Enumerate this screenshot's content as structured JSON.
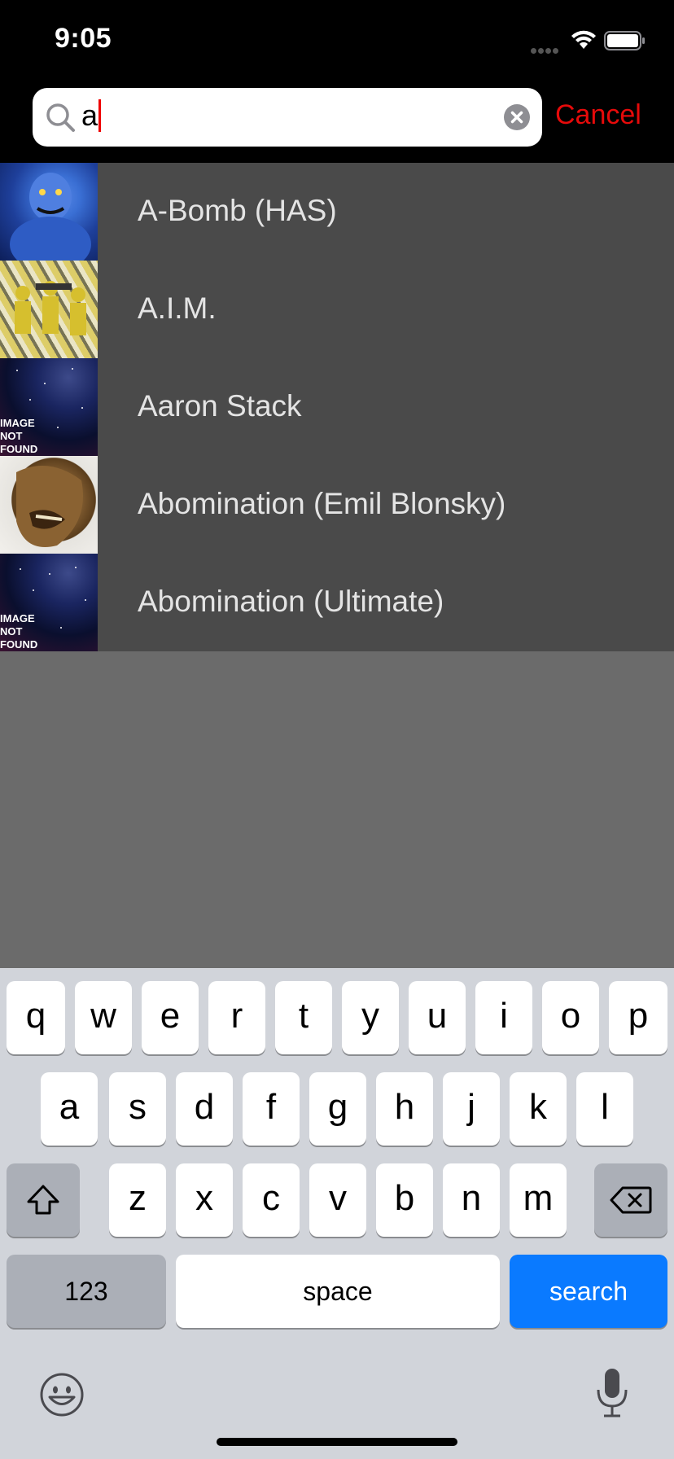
{
  "status_bar": {
    "time": "9:05"
  },
  "search": {
    "value": "a",
    "cancel_label": "Cancel",
    "caret_color": "#e00000"
  },
  "results": [
    {
      "label": "A-Bomb (HAS)",
      "thumb": "a-bomb-image"
    },
    {
      "label": "A.I.M.",
      "thumb": "aim-image"
    },
    {
      "label": "Aaron Stack",
      "thumb": "image-not-found",
      "thumb_text": [
        "IMAGE",
        "NOT",
        "FOUND"
      ]
    },
    {
      "label": "Abomination (Emil Blonsky)",
      "thumb": "abomination-image"
    },
    {
      "label": "Abomination (Ultimate)",
      "thumb": "image-not-found",
      "thumb_text": [
        "IMAGE",
        "NOT",
        "FOUND"
      ]
    }
  ],
  "keyboard": {
    "row1": [
      "q",
      "w",
      "e",
      "r",
      "t",
      "y",
      "u",
      "i",
      "o",
      "p"
    ],
    "row2": [
      "a",
      "s",
      "d",
      "f",
      "g",
      "h",
      "j",
      "k",
      "l"
    ],
    "row3": [
      "z",
      "x",
      "c",
      "v",
      "b",
      "n",
      "m"
    ],
    "numbers_label": "123",
    "space_label": "space",
    "search_label": "search",
    "shift_icon": "shift-icon",
    "backspace_icon": "backspace-icon",
    "emoji_icon": "emoji-icon",
    "mic_icon": "microphone-icon"
  },
  "colors": {
    "accent": "#e60a0a",
    "search_key": "#0a7aff",
    "results_bg": "#4a4a4a",
    "dim_bg": "#6b6b6b"
  }
}
